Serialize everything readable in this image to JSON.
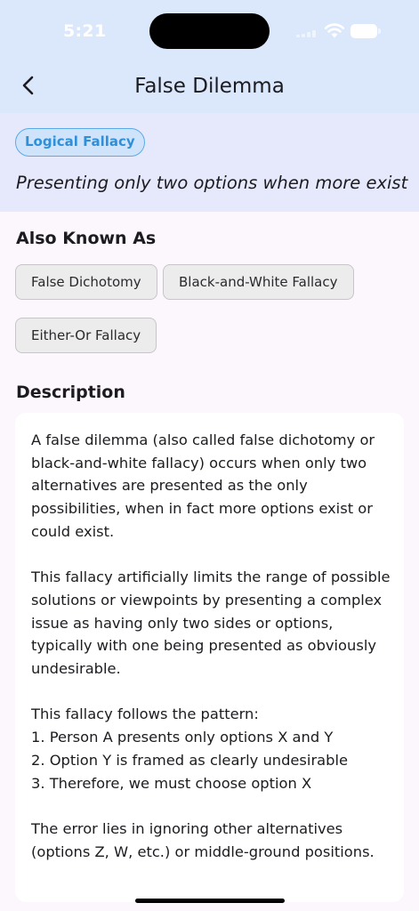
{
  "status_bar": {
    "time": "5:21"
  },
  "app_bar": {
    "title": "False Dilemma"
  },
  "header": {
    "category": "Logical Fallacy",
    "summary": "Presenting only two options when more exist"
  },
  "also_known_as": {
    "heading": "Also Known As",
    "aliases": [
      "False Dichotomy",
      "Black-and-White Fallacy",
      "Either-Or Fallacy"
    ]
  },
  "description": {
    "heading": "Description",
    "text": "A false dilemma (also called false dichotomy or black-and-white fallacy) occurs when only two alternatives are presented as the only possibilities, when in fact more options exist or could exist.\n\nThis fallacy artificially limits the range of possible solutions or viewpoints by presenting a complex issue as having only two sides or options, typically with one being presented as obviously undesirable.\n\nThis fallacy follows the pattern:\n1. Person A presents only options X and Y\n2. Option Y is framed as clearly undesirable\n3. Therefore, we must choose option X\n\nThe error lies in ignoring other alternatives (options Z, W, etc.) or middle-ground positions."
  }
}
